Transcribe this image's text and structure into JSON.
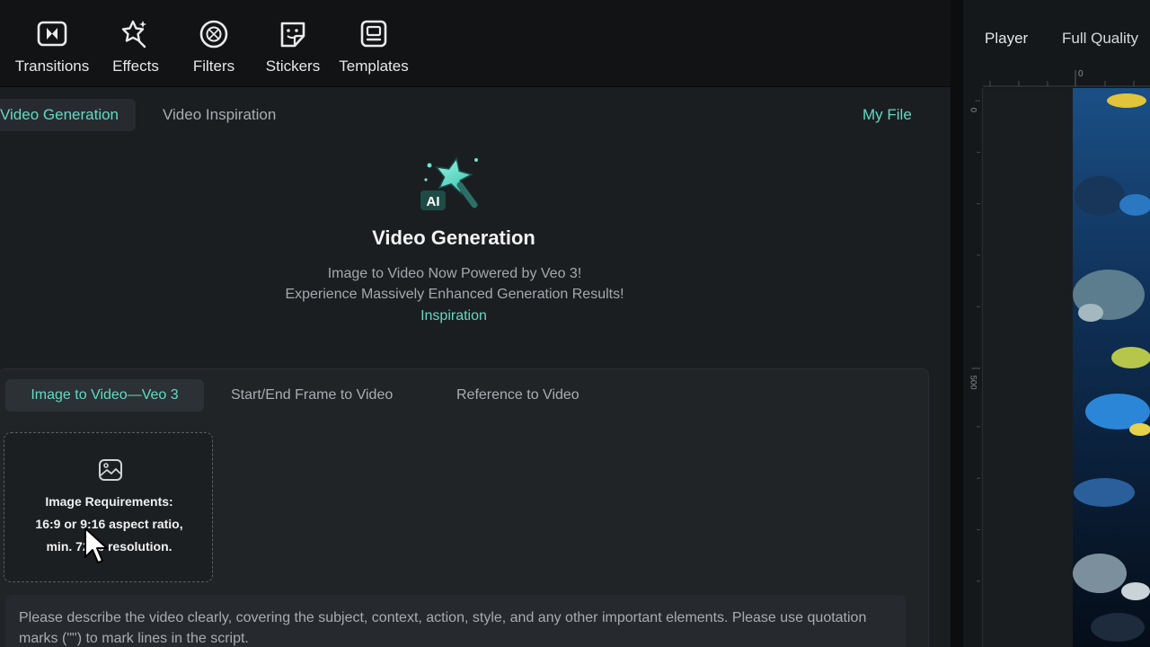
{
  "toolbar": {
    "items": [
      {
        "label": "Transitions",
        "icon": "transitions-icon"
      },
      {
        "label": "Effects",
        "icon": "effects-icon"
      },
      {
        "label": "Filters",
        "icon": "filters-icon"
      },
      {
        "label": "Stickers",
        "icon": "stickers-icon"
      },
      {
        "label": "Templates",
        "icon": "templates-icon"
      }
    ]
  },
  "subtabs": {
    "active": "Video Generation",
    "other": "Video Inspiration",
    "my_file": "My File"
  },
  "hero": {
    "badge": "AI",
    "title": "Video Generation",
    "line1": "Image to Video Now Powered by Veo 3!",
    "line2": "Experience Massively Enhanced Generation Results!",
    "link": "Inspiration"
  },
  "modes": {
    "items": [
      "Image to Video—Veo 3",
      "Start/End Frame to Video",
      "Reference to Video"
    ]
  },
  "upload": {
    "line1": "Image Requirements:",
    "line2": "16:9 or 9:16 aspect ratio,",
    "line3": "min. 720p resolution."
  },
  "prompt": {
    "text": "Please describe the video clearly, covering the subject, context, action, style, and any other important elements. Please use quotation marks (\"\") to mark lines in the script."
  },
  "player": {
    "label": "Player",
    "quality": "Full Quality",
    "ruler_top_zero": "0",
    "ruler_left_zero": "0",
    "ruler_left_mark": "500"
  },
  "colors": {
    "accent": "#63d9c3",
    "panel": "#1b1e21",
    "toolbar": "#111315"
  }
}
